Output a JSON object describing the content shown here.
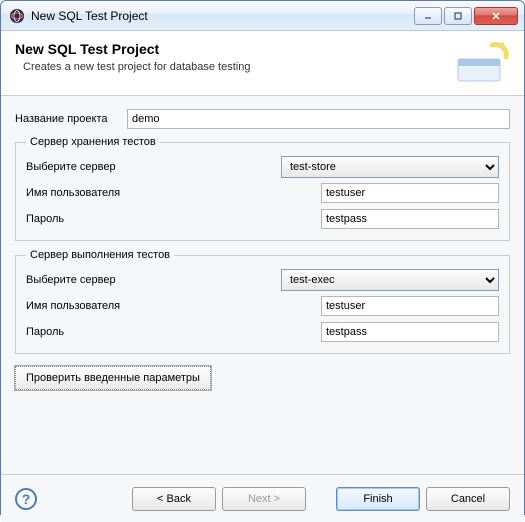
{
  "window": {
    "title": "New SQL Test Project"
  },
  "banner": {
    "title": "New SQL Test Project",
    "subtitle": "Creates a new test project for database testing"
  },
  "form": {
    "project_name_label": "Название проекта",
    "project_name_value": "demo",
    "storage": {
      "legend": "Сервер хранения тестов",
      "server_label": "Выберите сервер",
      "server_value": "test-store",
      "user_label": "Имя пользователя",
      "user_value": "testuser",
      "pass_label": "Пароль",
      "pass_value": "testpass"
    },
    "exec": {
      "legend": "Сервер выполнения тестов",
      "server_label": "Выберите сервер",
      "server_value": "test-exec",
      "user_label": "Имя пользователя",
      "user_value": "testuser",
      "pass_label": "Пароль",
      "pass_value": "testpass"
    },
    "verify_label": "Проверить введенные параметры"
  },
  "footer": {
    "back": "< Back",
    "next": "Next >",
    "finish": "Finish",
    "cancel": "Cancel"
  }
}
